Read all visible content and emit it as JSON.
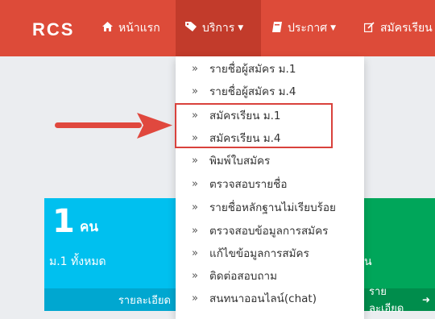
{
  "colors": {
    "navbar": "#dd4b39",
    "active_nav": "#c23b2b",
    "highlight": "#d9423c",
    "info_box": "#00c0ef",
    "success_box": "#00a65a"
  },
  "navbar": {
    "brand": "RCS",
    "items": [
      {
        "icon": "home-icon",
        "label": "หน้าแรก"
      },
      {
        "icon": "tag-icon",
        "label": "บริการ"
      },
      {
        "icon": "book-icon",
        "label": "ประกาศ"
      },
      {
        "icon": "edit-icon",
        "label": "สมัครเรียน"
      }
    ]
  },
  "dropdown": {
    "items": [
      {
        "label": "รายชื่อผู้สมัคร ม.1"
      },
      {
        "label": "รายชื่อผู้สมัคร ม.4"
      },
      {
        "label": "สมัครเรียน ม.1"
      },
      {
        "label": "สมัครเรียน ม.4"
      },
      {
        "label": "พิมพ์ใบสมัคร"
      },
      {
        "label": "ตรวจสอบรายชื่อ"
      },
      {
        "label": "รายชื่อหลักฐานไม่เรียบร้อย"
      },
      {
        "label": "ตรวจสอบข้อมูลการสมัคร"
      },
      {
        "label": "แก้ไขข้อมูลการสมัคร"
      },
      {
        "label": "ติดต่อสอบถาม"
      },
      {
        "label": "สนทนาออนไลน์(chat)"
      }
    ]
  },
  "stat_boxes": {
    "m1": {
      "count": "1",
      "unit": "คน",
      "label": "ม.1 ทั้งหมด",
      "footer": "รายละเอียด"
    },
    "m4": {
      "label": "น",
      "footer": "รายละเอียด"
    }
  }
}
